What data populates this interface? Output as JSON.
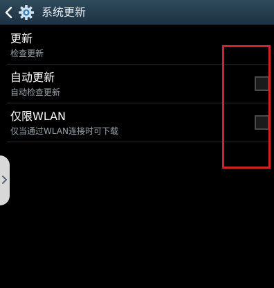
{
  "header": {
    "title": "系统更新",
    "back_icon": "back-chevron-icon",
    "app_icon": "gear-icon"
  },
  "settings": [
    {
      "label": "更新",
      "sub": "检查更新",
      "has_checkbox": false
    },
    {
      "label": "自动更新",
      "sub": "自动检查更新",
      "has_checkbox": true,
      "checked": false
    },
    {
      "label": "仅限WLAN",
      "sub": "仅当通过WLAN连接时可下载",
      "has_checkbox": true,
      "checked": false
    }
  ],
  "colors": {
    "header_bg": "#24394a",
    "highlight": "#d3202a",
    "background": "#000000"
  }
}
